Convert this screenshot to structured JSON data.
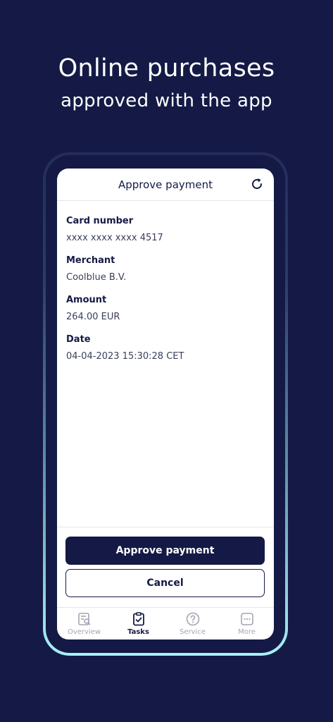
{
  "promo": {
    "headline": "Online purchases",
    "subheadline": "approved with the app"
  },
  "screen": {
    "title": "Approve payment",
    "refresh_icon": "refresh-icon",
    "fields": [
      {
        "label": "Card number",
        "value": "xxxx xxxx xxxx 4517"
      },
      {
        "label": "Merchant",
        "value": "Coolblue B.V."
      },
      {
        "label": "Amount",
        "value": "264.00 EUR"
      },
      {
        "label": "Date",
        "value": "04-04-2023 15:30:28 CET"
      }
    ],
    "approve_label": "Approve payment",
    "cancel_label": "Cancel"
  },
  "tabs": [
    {
      "label": "Overview",
      "icon": "overview-icon",
      "active": false
    },
    {
      "label": "Tasks",
      "icon": "clipboard-check-icon",
      "active": true
    },
    {
      "label": "Service",
      "icon": "question-circle-icon",
      "active": false
    },
    {
      "label": "More",
      "icon": "more-dots-icon",
      "active": false
    }
  ],
  "colors": {
    "background": "#141a45",
    "primary": "#141a45",
    "frame_glow": "#a7f0f6",
    "inactive_tab": "#a2a5b4"
  }
}
